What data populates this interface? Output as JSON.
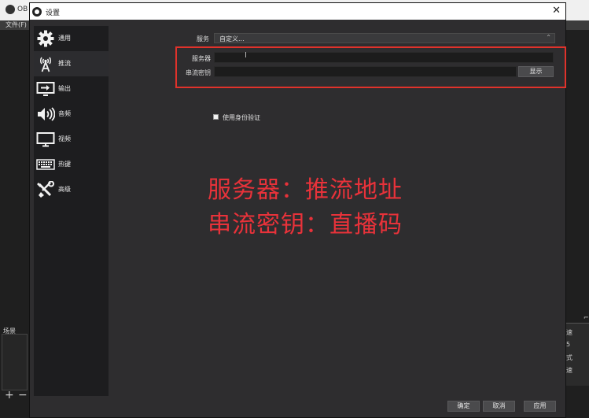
{
  "background": {
    "app_title": "OB",
    "menu": "文件(F)",
    "scenes_label": "场景",
    "right_panel_texts": [
      "⌐",
      "速",
      "5",
      "式",
      "速"
    ]
  },
  "dialog": {
    "title": "设置",
    "close": "✕"
  },
  "sidebar": {
    "items": [
      {
        "label": "通用",
        "icon": "gear-icon"
      },
      {
        "label": "推流",
        "icon": "antenna-icon"
      },
      {
        "label": "输出",
        "icon": "output-monitor-icon"
      },
      {
        "label": "音频",
        "icon": "speaker-icon"
      },
      {
        "label": "视频",
        "icon": "monitor-icon"
      },
      {
        "label": "热键",
        "icon": "keyboard-icon"
      },
      {
        "label": "高级",
        "icon": "tools-icon"
      }
    ],
    "active": "推流"
  },
  "stream": {
    "service_label": "服务",
    "service_value": "自定义...",
    "server_label": "服务器",
    "server_value": "",
    "key_label": "串流密钥",
    "key_value": "",
    "show_button": "显示",
    "auth_checkbox_label": "使用身份验证",
    "auth_checked": false
  },
  "annotation": {
    "line1": "服务器：推流地址",
    "line2": "串流密钥：直播码",
    "color": "#e8323a"
  },
  "footer": {
    "ok": "确定",
    "cancel": "取消",
    "apply": "应用"
  }
}
